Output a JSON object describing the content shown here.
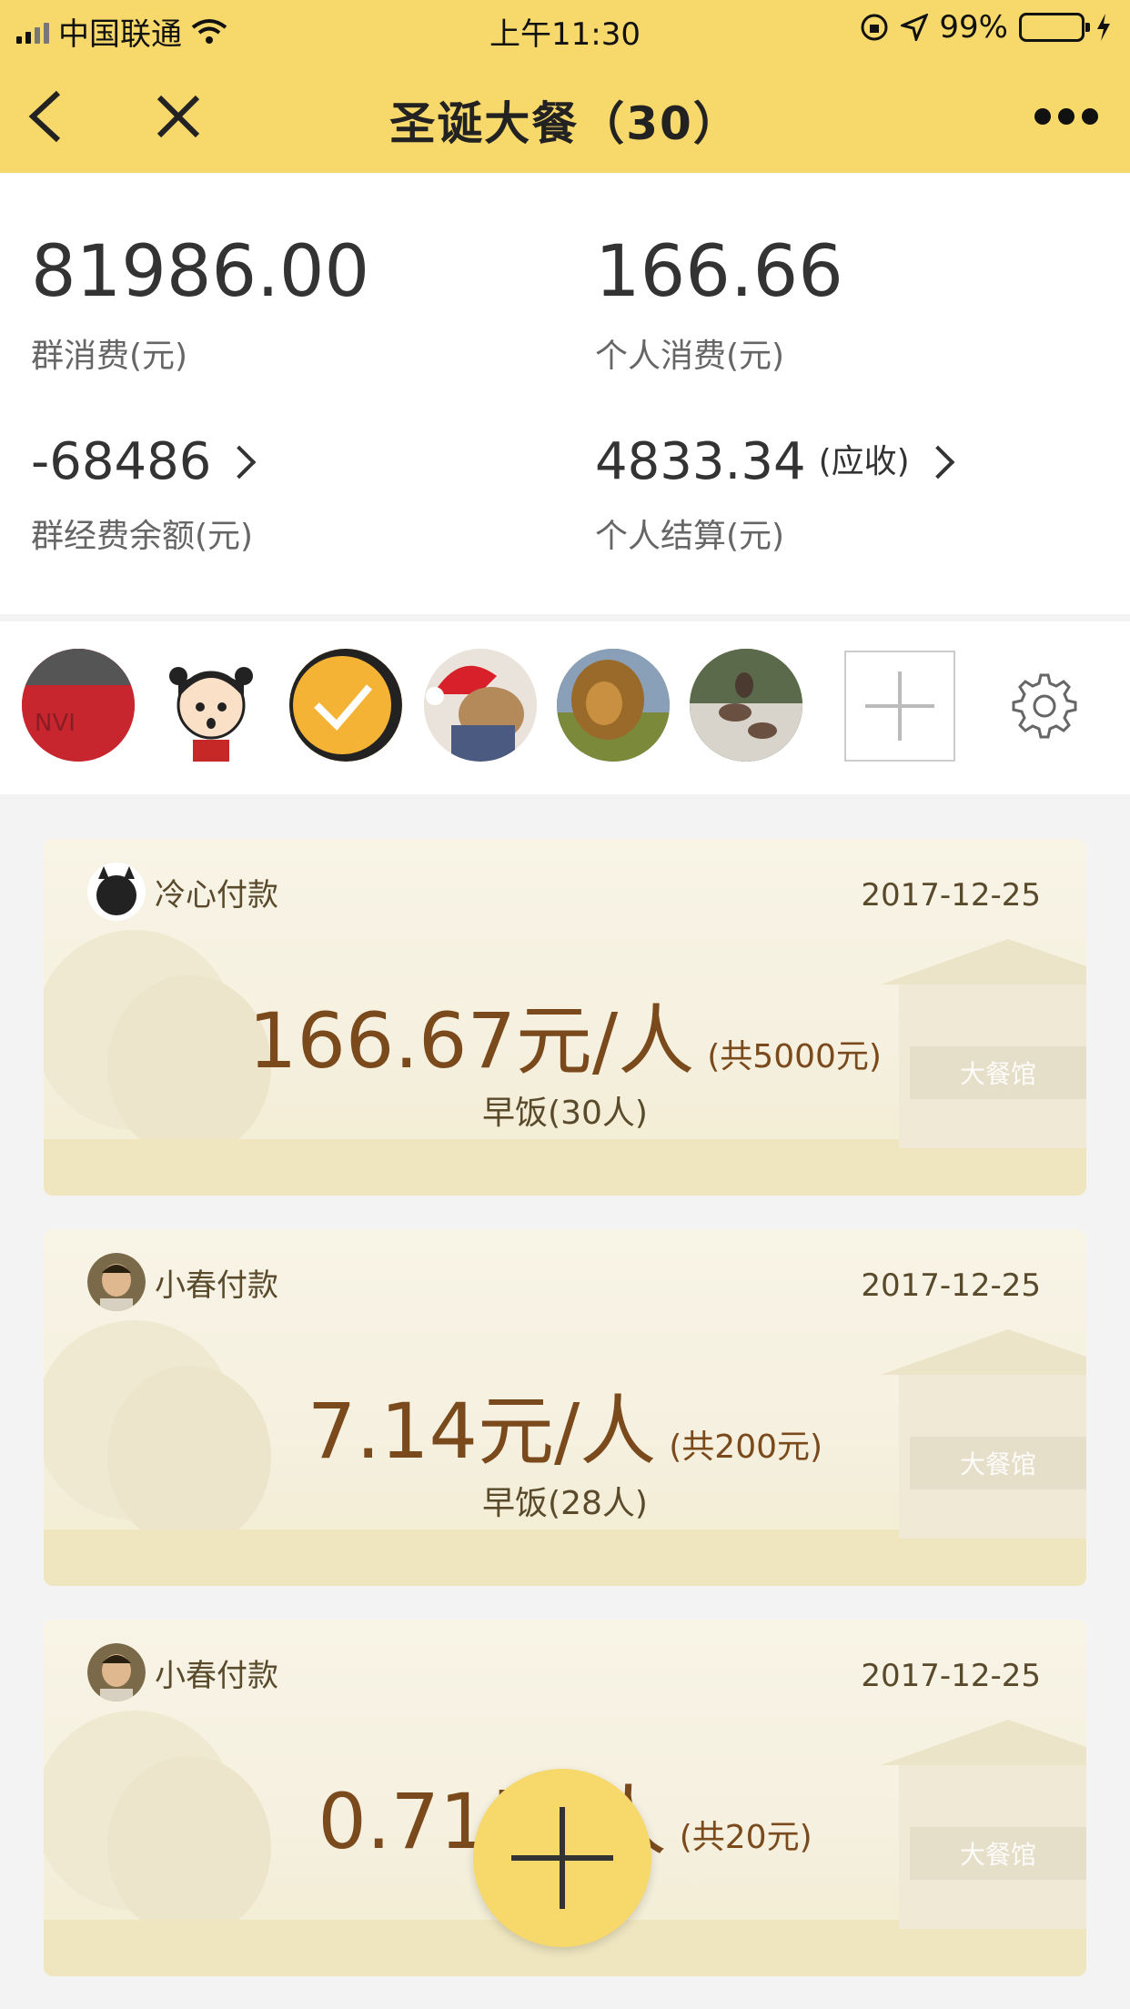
{
  "status_bar": {
    "carrier": "中国联通",
    "time": "上午11:30",
    "battery": "99%"
  },
  "nav": {
    "title": "圣诞大餐（30）"
  },
  "summary": {
    "group_spend_value": "81986.00",
    "group_spend_label": "群消费(元)",
    "personal_spend_value": "166.66",
    "personal_spend_label": "个人消费(元)",
    "group_fund_value": "-68486",
    "group_fund_label": "群经费余额(元)",
    "personal_settle_value": "4833.34",
    "personal_settle_note": "(应收)",
    "personal_settle_label": "个人结算(元)"
  },
  "members": {
    "avatars": [
      "member-1",
      "member-2",
      "member-3",
      "member-4",
      "member-5",
      "member-6"
    ]
  },
  "expenses": [
    {
      "payer": "冷心付款",
      "date": "2017-12-25",
      "per_person": "166.67元/人",
      "total": "(共5000元)",
      "meal": "早饭(30人)",
      "restaurant": "大餐馆"
    },
    {
      "payer": "小春付款",
      "date": "2017-12-25",
      "per_person": "7.14元/人",
      "total": "(共200元)",
      "meal": "早饭(28人)",
      "restaurant": "大餐馆"
    },
    {
      "payer": "小春付款",
      "date": "2017-12-25",
      "per_person": "0.71元/人",
      "total": "(共20元)",
      "meal": "",
      "restaurant": "大餐馆"
    }
  ],
  "colors": {
    "accent": "#f7d86b",
    "amount_text": "#7a4a1c",
    "card_bg": "#f8f4e6"
  }
}
